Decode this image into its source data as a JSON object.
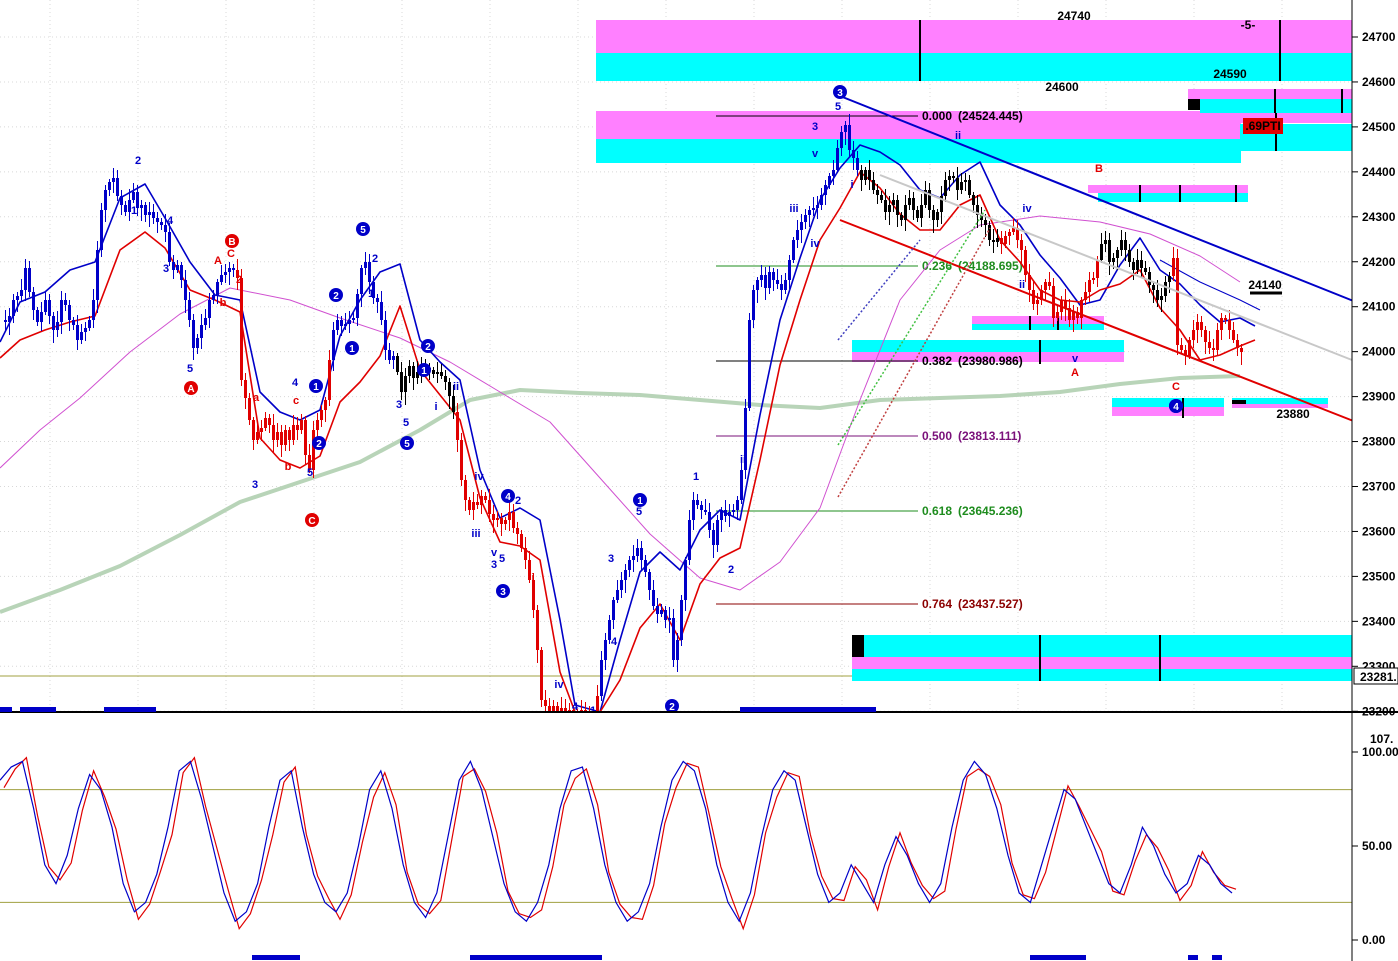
{
  "colors": {
    "magenta_zone": "#ff80ff",
    "cyan_zone": "#00ffff",
    "blue": "#0000c8",
    "red": "#e00000",
    "ma_long": "#b8d4b8",
    "ma_mid": "#d050d0",
    "olive": "#a0a040",
    "grid": "#d8d8d8",
    "fib": [
      "#000000",
      "#1e8c1e",
      "#000000",
      "#7a107a",
      "#1e8c1e",
      "#8b0000"
    ]
  },
  "chart_data": {
    "type": "candlestick",
    "price_axis": {
      "ticks": [
        "24700",
        "24600",
        "24500",
        "24400",
        "24300",
        "24200",
        "24100",
        "24000",
        "23900",
        "23800",
        "23700",
        "23600",
        "23500",
        "23400",
        "23300",
        "23200"
      ],
      "range": [
        23170,
        24780
      ],
      "current_price_label": "23281."
    },
    "oscillator_axis": {
      "ticks": [
        "100.00",
        "50.00",
        "0.00"
      ],
      "top_label": "107.",
      "range": [
        -5,
        110
      ],
      "reference_levels": [
        80,
        20
      ]
    },
    "fibonacci": [
      {
        "label": "0.000",
        "value": "(24524.445)"
      },
      {
        "label": "0.236",
        "value": "(24188.695)"
      },
      {
        "label": "0.382",
        "value": "(23980.986)"
      },
      {
        "label": "0.500",
        "value": "(23813.111)"
      },
      {
        "label": "0.618",
        "value": "(23645.236)"
      },
      {
        "label": "0.764",
        "value": "(23437.527)"
      }
    ],
    "price_labels": [
      "24740",
      "24600",
      "24590",
      "24140",
      "23880"
    ],
    "tag_labels": [
      "-5-",
      ".69PTI"
    ],
    "wave_labels": {
      "circled": [
        "3",
        "1",
        "1",
        "2",
        "2",
        "2",
        "4",
        "5",
        "5",
        "3",
        "2",
        "1",
        "1",
        "4",
        "4",
        "A",
        "B",
        "C"
      ],
      "plain": [
        "2",
        "4",
        "1",
        "3",
        "5",
        "2",
        "A",
        "C",
        "b",
        "a",
        "c",
        "4",
        "b",
        "3",
        "5",
        "2",
        "1",
        "3",
        "5",
        "ii",
        "i",
        "iv",
        "iii",
        "v",
        "3",
        "5",
        "2",
        "i",
        "iv",
        "4",
        "1",
        "3",
        "4",
        "5",
        "1",
        "2",
        "ii",
        "5",
        "3",
        "v",
        "i",
        "iii",
        "iv",
        "ii",
        "iv",
        "ii",
        "v",
        "A",
        "B",
        "C"
      ]
    }
  }
}
